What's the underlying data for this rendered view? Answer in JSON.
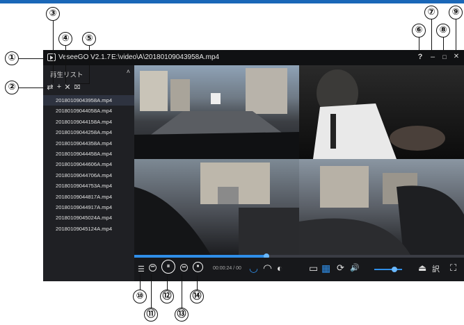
{
  "app": {
    "title": "VeseeGO V2.1.7",
    "file_path": "E:\\video\\A\\20180109043958A.mp4",
    "accent_color": "#1a67b8"
  },
  "window_buttons": {
    "help": "?",
    "minimize": "–",
    "maximize": "□",
    "close": "✕"
  },
  "playlist": {
    "title": "再生リスト",
    "collapse": "˄",
    "tools": [
      "repeat-icon",
      "add-icon",
      "remove-icon",
      "clear-icon"
    ],
    "tool_glyphs": [
      "⇄",
      "+",
      "✕",
      "⌧"
    ],
    "items": [
      "20180109043958A.mp4",
      "20180109044058A.mp4",
      "20180109044158A.mp4",
      "20180109044258A.mp4",
      "20180109044358A.mp4",
      "20180109044458A.mp4",
      "20180109044606A.mp4",
      "20180109044706A.mp4",
      "20180109044753A.mp4",
      "20180109044817A.mp4",
      "20180109044917A.mp4",
      "20180109045024A.mp4",
      "20180109045124A.mp4"
    ],
    "selected_index": 0
  },
  "playback": {
    "time": "00:00:24 / 00",
    "progress": 0.4,
    "volume": 0.7
  },
  "controls": {
    "playlist_toggle": "☰",
    "prev": "⏮",
    "pause": "⏸",
    "next": "⏭",
    "stop": "⏹",
    "view_front": "◡",
    "view_rear": "◠",
    "view_side": "◐",
    "layout_two": "▭",
    "layout_four": "▦",
    "rotate": "⟳",
    "volume": "🔊",
    "eject": "⏏",
    "translate": "訳",
    "fullscreen": "⛶"
  },
  "callouts": [
    "①",
    "②",
    "③",
    "④",
    "⑤",
    "⑥",
    "⑦",
    "⑧",
    "⑨",
    "⑩",
    "⑪",
    "⑫",
    "⑬",
    "⑭"
  ]
}
